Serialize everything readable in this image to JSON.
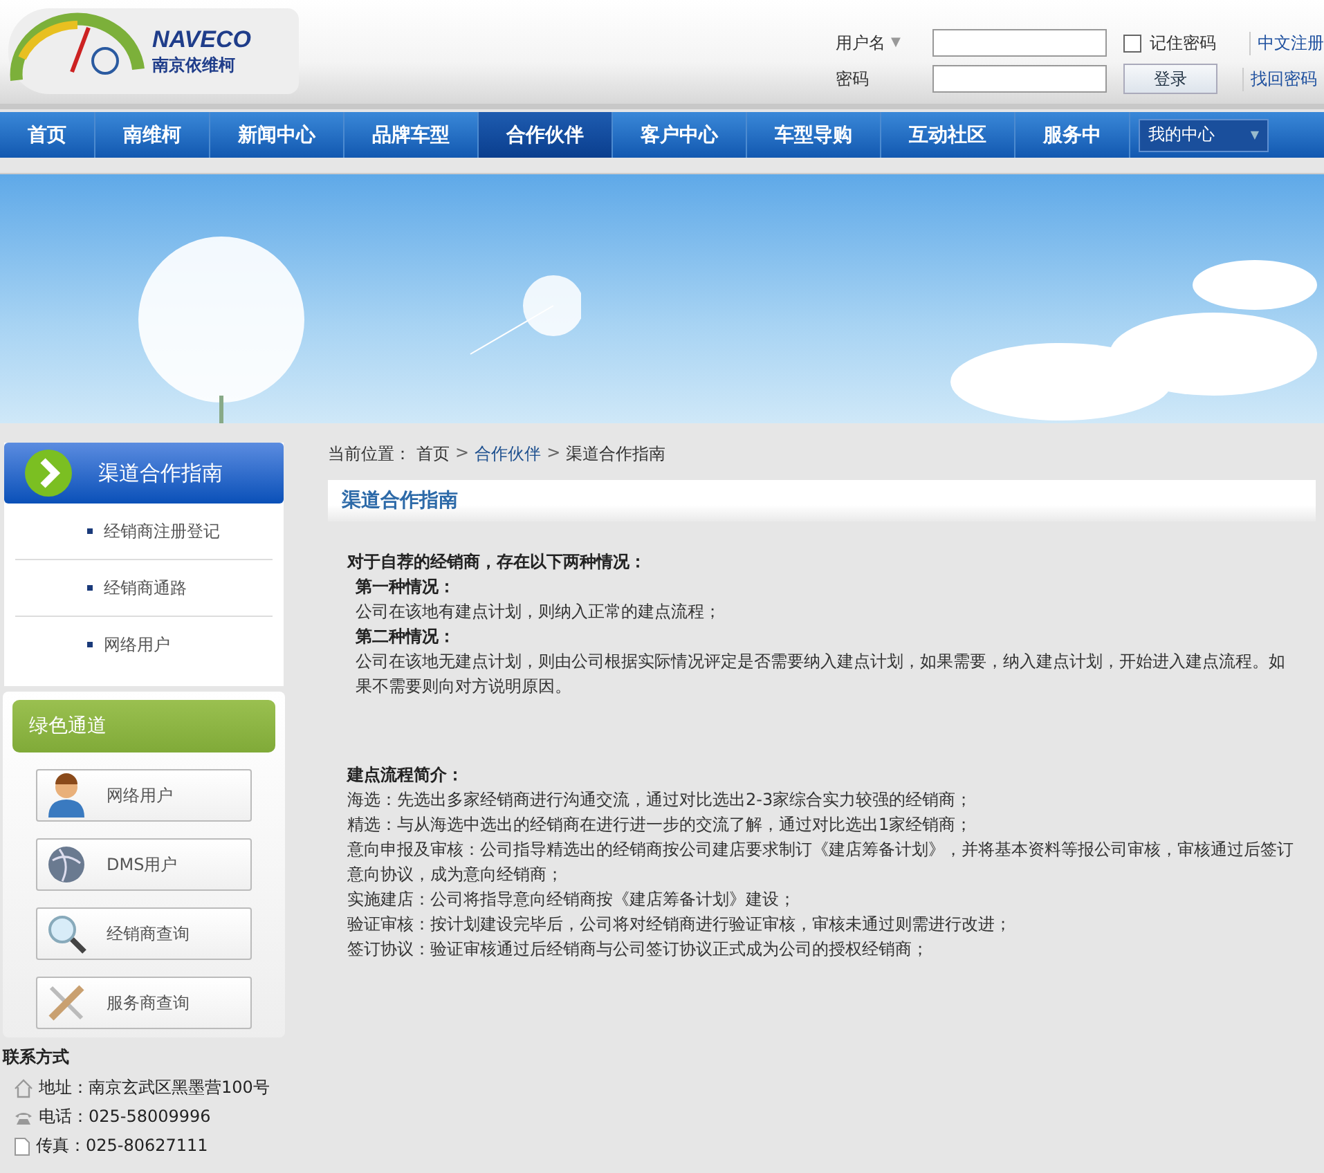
{
  "header": {
    "logo": {
      "brand": "NAVECO",
      "name_cn": "南京依维柯"
    },
    "login": {
      "username_label": "用户名",
      "dropdown_arrow": "▼",
      "password_label": "密码",
      "remember": {
        "label": "记住密码",
        "checked": false
      },
      "login_button": "登录",
      "links": [
        "中文注册",
        "找回密码"
      ]
    }
  },
  "nav": {
    "items": [
      {
        "label": "首页",
        "selected": false
      },
      {
        "label": "南维柯",
        "selected": false
      },
      {
        "label": "新闻中心",
        "selected": false
      },
      {
        "label": "品牌车型",
        "selected": false
      },
      {
        "label": "合作伙伴",
        "selected": true
      },
      {
        "label": "客户中心",
        "selected": false
      },
      {
        "label": "车型导购",
        "selected": false
      },
      {
        "label": "互动社区",
        "selected": false
      },
      {
        "label": "服务中",
        "selected": false
      }
    ],
    "my_center": {
      "label": "我的中心",
      "arrow": "▼"
    }
  },
  "sidebar": {
    "title": "渠道合作指南",
    "items": [
      "经销商注册登记",
      "经销商通路",
      "网络用户"
    ],
    "green_channel": {
      "title": "绿色通道",
      "buttons": [
        {
          "kind": "user",
          "label": "网络用户"
        },
        {
          "kind": "globe",
          "label": "DMS用户"
        },
        {
          "kind": "search",
          "label": "经销商查询"
        },
        {
          "kind": "tools",
          "label": "服务商查询"
        }
      ]
    },
    "contact": {
      "title": "联系方式",
      "lines": [
        {
          "kind": "home",
          "text": "地址：南京玄武区黑墨营100号"
        },
        {
          "kind": "phone",
          "text": "电话：025-58009996"
        },
        {
          "kind": "fax",
          "text": "传真：025-80627111"
        }
      ]
    }
  },
  "breadcrumb": {
    "prefix": "当前位置：",
    "items": [
      {
        "label": "首页",
        "current": false
      },
      {
        "label": "合作伙伴",
        "current": true
      },
      {
        "label": "渠道合作指南",
        "current": false
      }
    ],
    "separator": ">"
  },
  "content": {
    "title": "渠道合作指南",
    "paragraphs": [
      {
        "kind": "heading",
        "text": "对于自荐的经销商，存在以下两种情况："
      },
      {
        "kind": "subheading",
        "text": "第一种情况："
      },
      {
        "kind": "text",
        "text": "公司在该地有建点计划，则纳入正常的建点流程；"
      },
      {
        "kind": "subheading",
        "text": "第二种情况："
      },
      {
        "kind": "text",
        "text": "公司在该地无建点计划，则由公司根据实际情况评定是否需要纳入建点计划，如果需要，纳入建点计划，开始进入建点流程。如果不需要则向对方说明原因。"
      },
      {
        "kind": "gap"
      },
      {
        "kind": "heading",
        "text": "建点流程简介："
      },
      {
        "kind": "plain",
        "text": "海选：先选出多家经销商进行沟通交流，通过对比选出2-3家综合实力较强的经销商；"
      },
      {
        "kind": "plain",
        "text": "精选：与从海选中选出的经销商在进行进一步的交流了解，通过对比选出1家经销商；"
      },
      {
        "kind": "plain",
        "text": "意向申报及审核：公司指导精选出的经销商按公司建店要求制订《建店筹备计划》，并将基本资料等报公司审核，审核通过后签订意向协议，成为意向经销商；"
      },
      {
        "kind": "plain",
        "text": "实施建店：公司将指导意向经销商按《建店筹备计划》建设；"
      },
      {
        "kind": "plain",
        "text": "验证审核：按计划建设完毕后，公司将对经销商进行验证审核，审核未通过则需进行改进；"
      },
      {
        "kind": "plain",
        "text": "签订协议：验证审核通过后经销商与公司签订协议正式成为公司的授权经销商；"
      }
    ]
  }
}
